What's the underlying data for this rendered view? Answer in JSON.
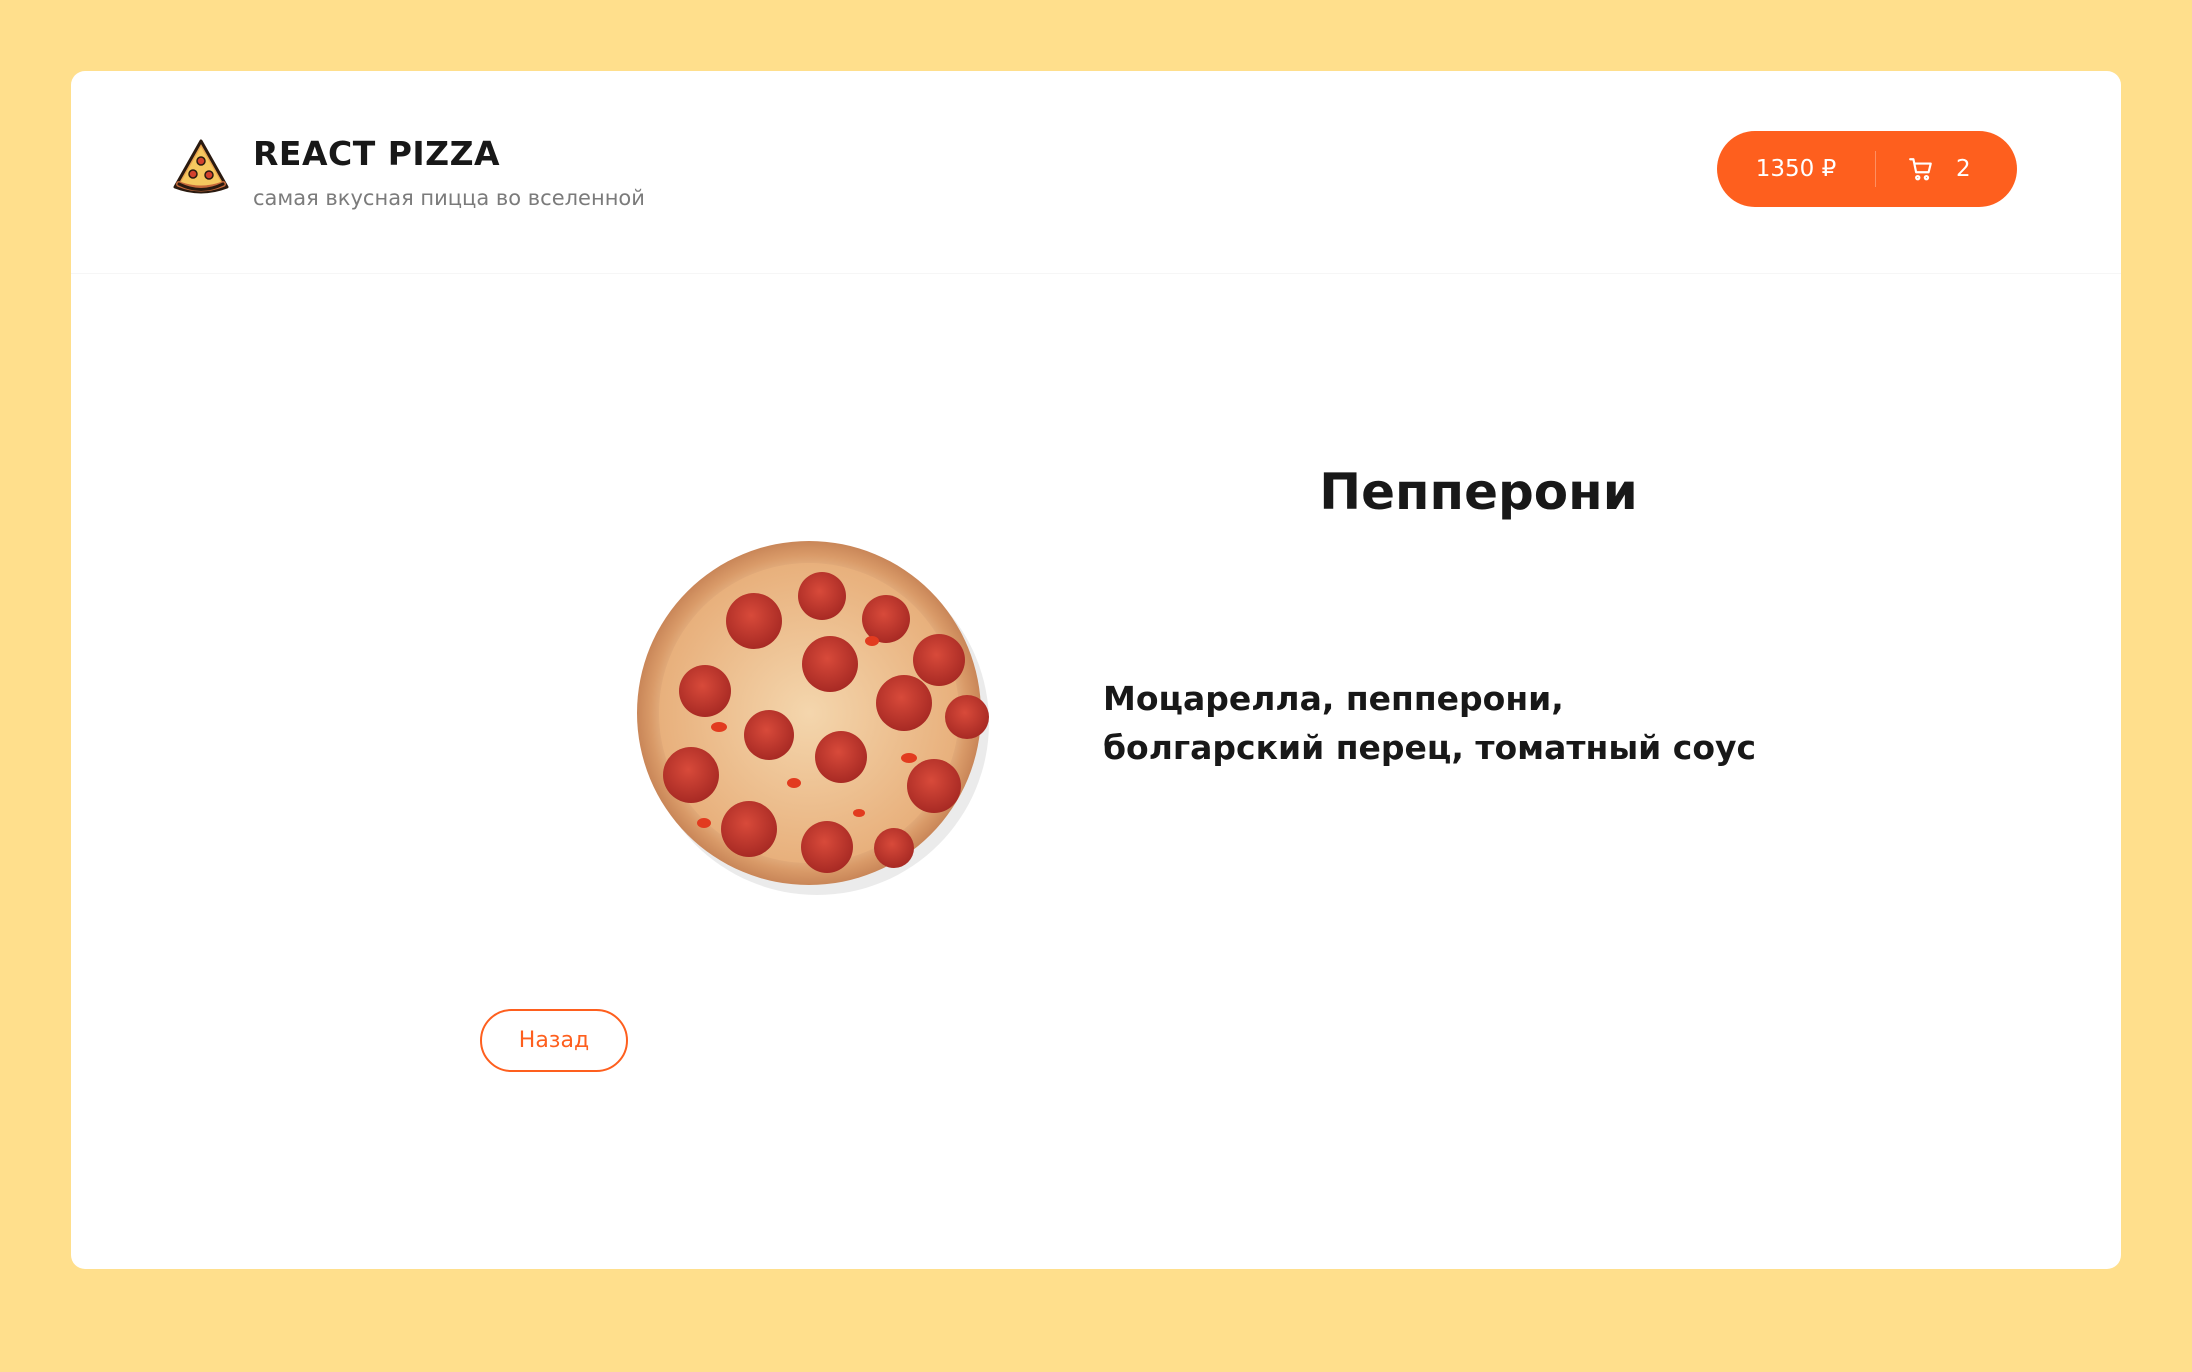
{
  "header": {
    "logo_icon": "pizza-slice-icon",
    "title": "REACT PIZZA",
    "subtitle": "самая вкусная пицца во вселенной"
  },
  "cart": {
    "total_price": "1350 ₽",
    "icon": "cart-icon",
    "count": "2"
  },
  "pizza": {
    "image": "pepperoni-pizza",
    "title": "Пепперони",
    "description": "Моцарелла, пепперони,\nболгарский перец, томатный соус"
  },
  "actions": {
    "back_label": "Назад"
  },
  "colors": {
    "accent": "#fe5f1e",
    "page_background": "#ffdf8c",
    "card_background": "#ffffff",
    "text": "#181818",
    "muted_text": "#7b7b7b"
  }
}
